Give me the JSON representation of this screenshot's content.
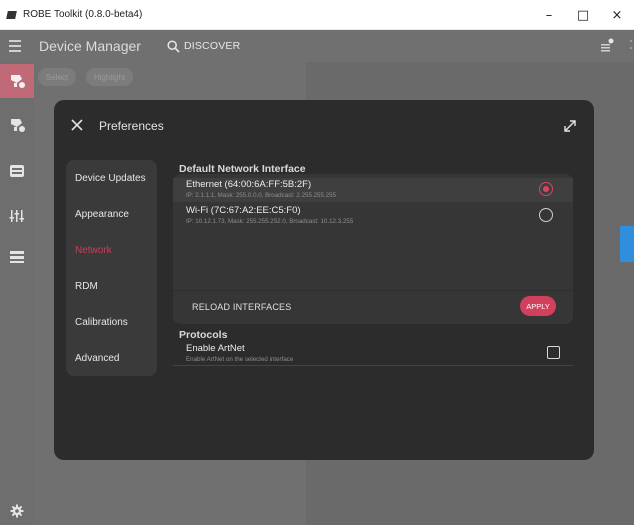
{
  "window": {
    "title": "ROBE Toolkit (0.8.0-beta4)",
    "minimize": "–",
    "maximize": "□",
    "close": "×"
  },
  "header": {
    "title": "Device Manager",
    "discover_label": "DISCOVER"
  },
  "background": {
    "chips": [
      "Select",
      "Highlight"
    ]
  },
  "rail": {
    "items": [
      "device-manager-icon",
      "fixtures-icon",
      "dmx-icon",
      "sliders-icon",
      "table-icon"
    ],
    "active_index": 0,
    "settings_icon": "gear-icon"
  },
  "dialog": {
    "title": "Preferences",
    "nav": [
      {
        "label": "Device Updates"
      },
      {
        "label": "Appearance"
      },
      {
        "label": "Network"
      },
      {
        "label": "RDM"
      },
      {
        "label": "Calibrations"
      },
      {
        "label": "Advanced"
      }
    ],
    "selected_nav": "Network",
    "network": {
      "section_title": "Default Network Interface",
      "interfaces": [
        {
          "name": "Ethernet (64:00:6A:FF:5B:2F)",
          "detail": "IP: 2.1.1.1, Mask: 255.0.0.0, Broadcast: 2.255.255.255",
          "selected": true
        },
        {
          "name": "Wi-Fi (7C:67:A2:EE:C5:F0)",
          "detail": "IP: 10.12.1.73, Mask: 255.255.252.0, Broadcast: 10.12.3.255",
          "selected": false
        }
      ],
      "reload_label": "RELOAD INTERFACES",
      "apply_label": "APPLY"
    },
    "protocols": {
      "section_title": "Protocols",
      "items": [
        {
          "name": "Enable ArtNet",
          "detail": "Enable ArtNet on the selected interface",
          "checked": false
        }
      ]
    }
  },
  "colors": {
    "accent": "#d2405c",
    "dialog_bg": "#2c2c2c",
    "panel_bg": "#363636",
    "rail_active": "#c06a78"
  }
}
